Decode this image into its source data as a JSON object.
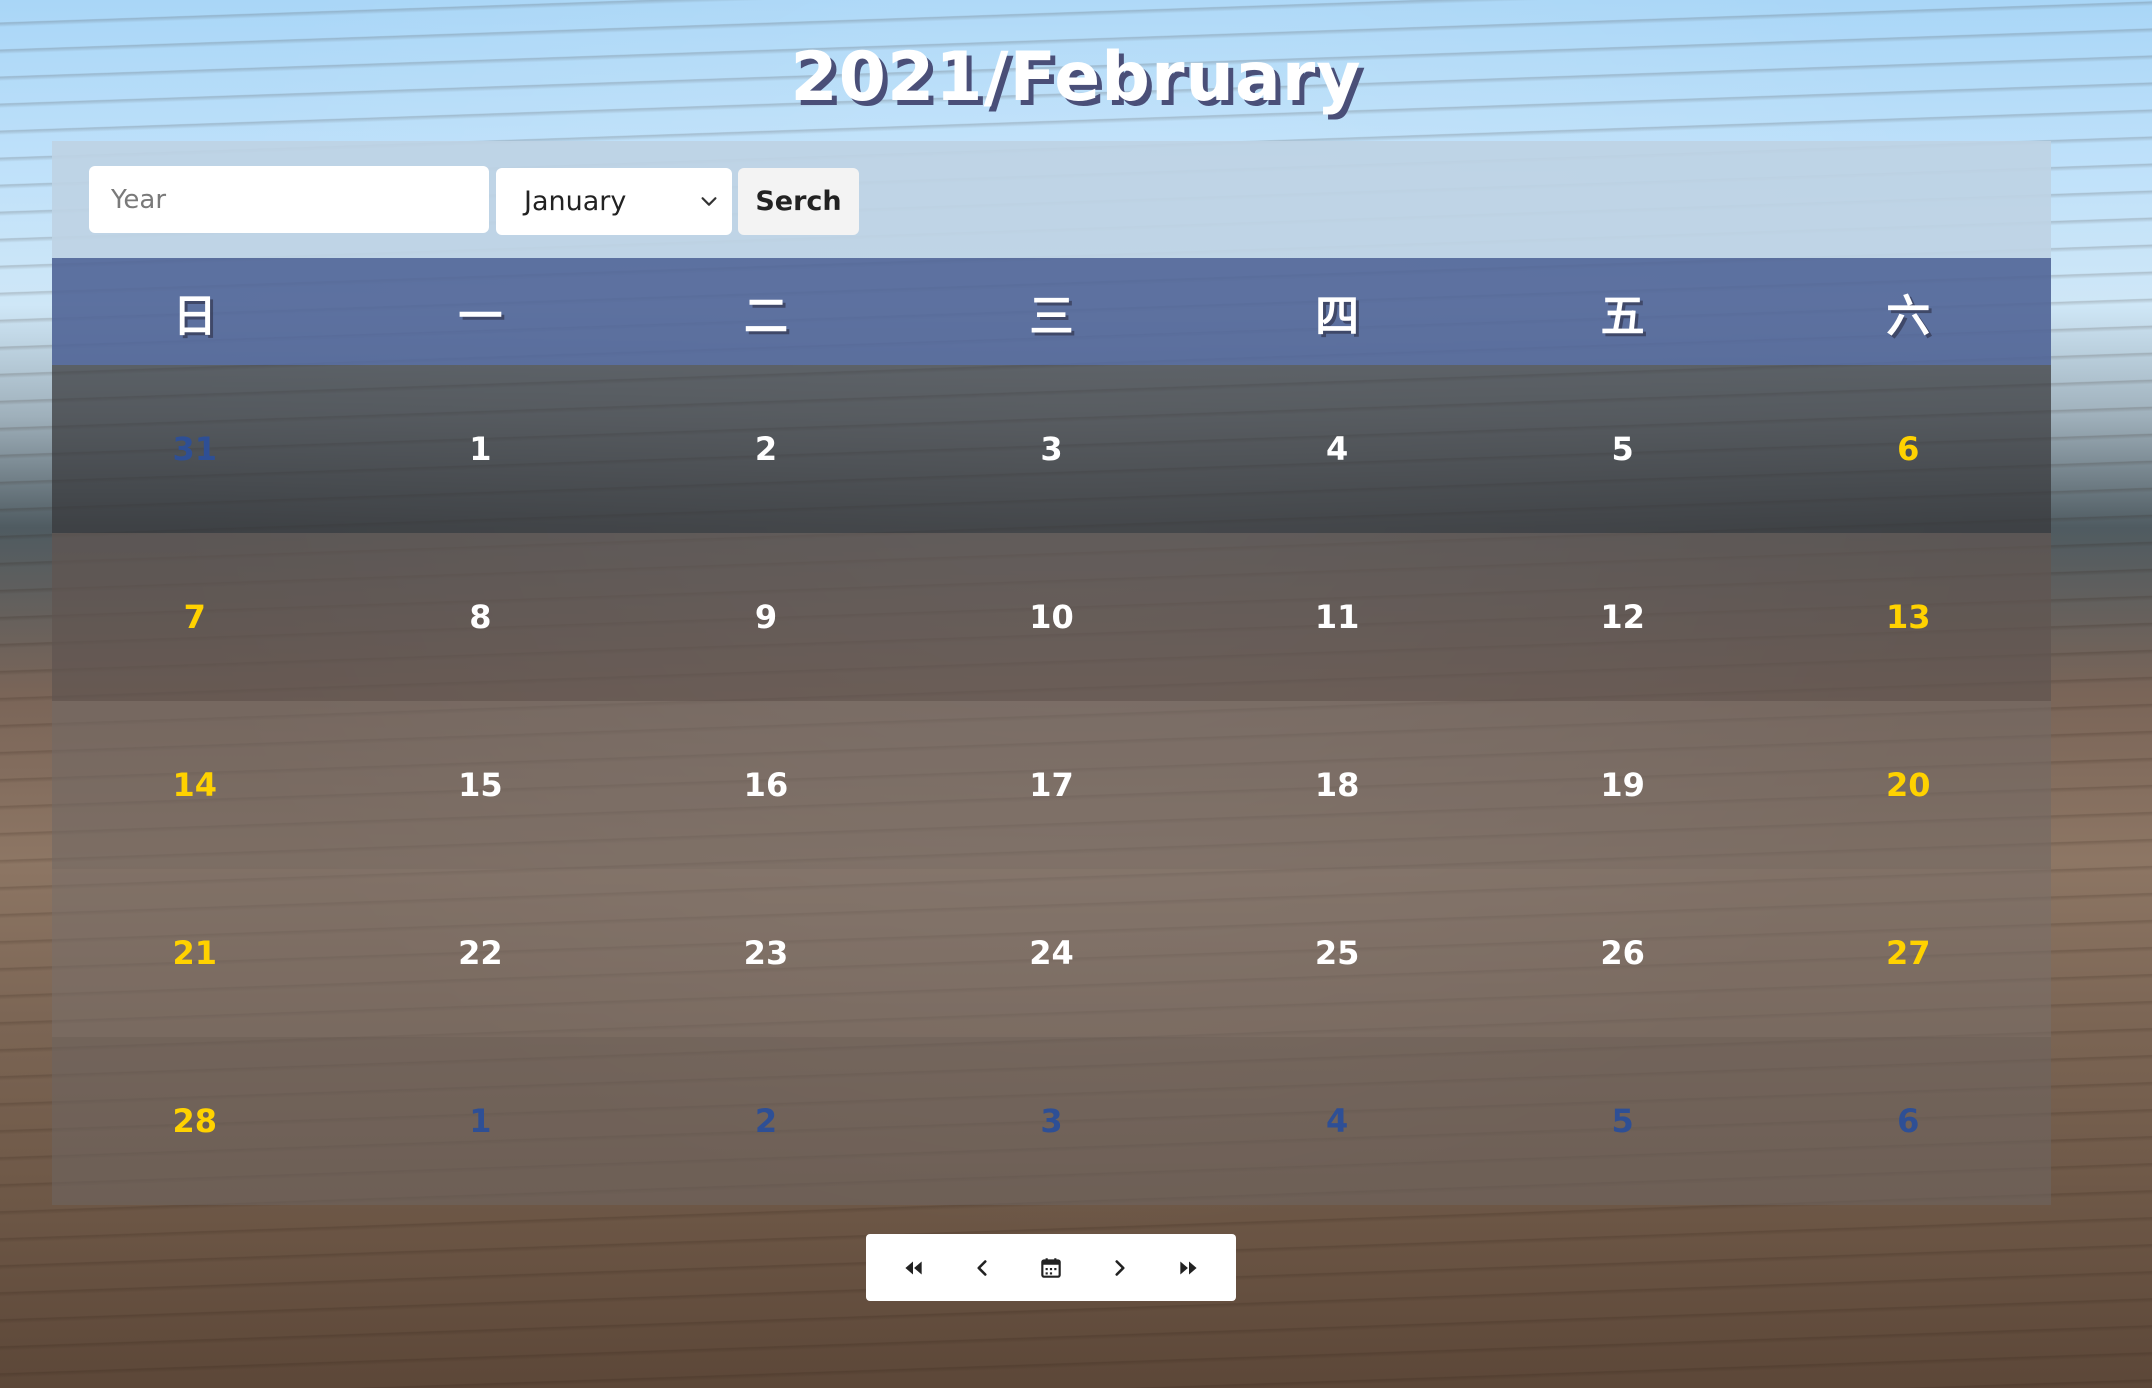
{
  "title": "2021/February",
  "search": {
    "year_placeholder": "Year",
    "month_selected": "January",
    "button_label": "Serch"
  },
  "weekdays": [
    "日",
    "一",
    "二",
    "三",
    "四",
    "五",
    "六"
  ],
  "weeks": [
    [
      "31",
      "1",
      "2",
      "3",
      "4",
      "5",
      "6"
    ],
    [
      "7",
      "8",
      "9",
      "10",
      "11",
      "12",
      "13"
    ],
    [
      "14",
      "15",
      "16",
      "17",
      "18",
      "19",
      "20"
    ],
    [
      "21",
      "22",
      "23",
      "24",
      "25",
      "26",
      "27"
    ],
    [
      "28",
      "1",
      "2",
      "3",
      "4",
      "5",
      "6"
    ]
  ],
  "colors": {
    "weekday_text": "#ffffff",
    "weekend_text": "#ffd200",
    "other_month_text": "#2e4f95",
    "header_bg": "#506496"
  },
  "nav": {
    "icons": [
      "first-page-icon",
      "previous-icon",
      "today-calendar-icon",
      "next-icon",
      "last-page-icon"
    ]
  }
}
